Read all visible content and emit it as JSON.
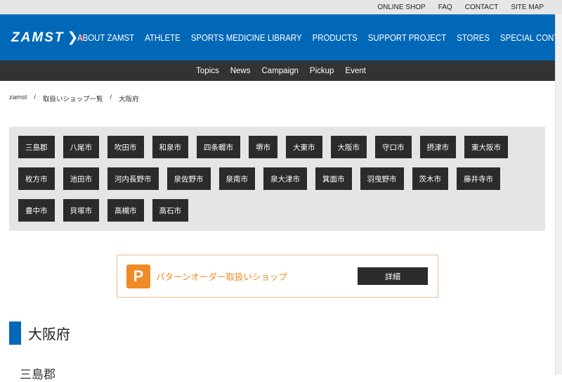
{
  "utility_nav": [
    "ONLINE SHOP",
    "FAQ",
    "CONTACT",
    "SITE MAP"
  ],
  "logo": "ZAMST",
  "main_nav": [
    "ABOUT ZAMST",
    "ATHLETE",
    "SPORTS MEDICINE LIBRARY",
    "PRODUCTS",
    "SUPPORT PROJECT",
    "STORES",
    "SPECIAL CONTENTS"
  ],
  "sub_nav": [
    "Topics",
    "News",
    "Campaign",
    "Pickup",
    "Event"
  ],
  "breadcrumb": [
    "zamst",
    "取扱いショップ一覧",
    "大阪府"
  ],
  "breadcrumb_sep": "/",
  "cities": [
    "三島郡",
    "八尾市",
    "吹田市",
    "和泉市",
    "四条畷市",
    "堺市",
    "大東市",
    "大阪市",
    "守口市",
    "摂津市",
    "東大阪市",
    "枚方市",
    "池田市",
    "河内長野市",
    "泉佐野市",
    "泉南市",
    "泉大津市",
    "箕面市",
    "羽曳野市",
    "茨木市",
    "藤井寺市",
    "豊中市",
    "貝塚市",
    "高槻市",
    "高石市"
  ],
  "banner": {
    "icon": "P",
    "title": "パターンオーダー取扱いショップ",
    "button": "詳細"
  },
  "section_title": "大阪府",
  "subsection_title": "三島郡",
  "colors": {
    "brand_blue": "#0068b7",
    "orange": "#f08a24",
    "dark": "#2b2b2b"
  }
}
